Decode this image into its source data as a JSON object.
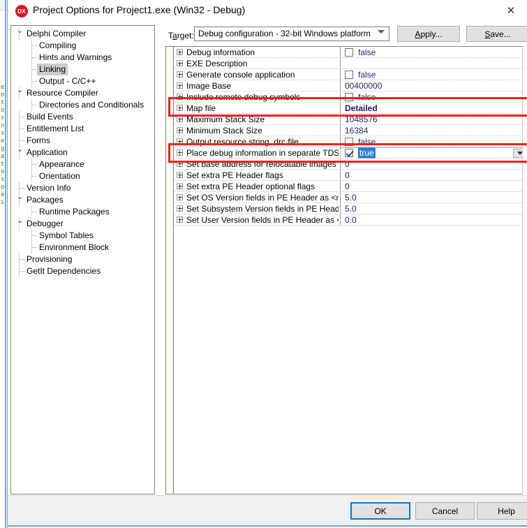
{
  "window": {
    "title": "Project Options for Project1.exe  (Win32 - Debug)",
    "logo_text": "DX",
    "close_icon": "close-icon"
  },
  "tree": {
    "items": [
      {
        "label": "Delphi Compiler",
        "depth": 0,
        "expander": "chevron-down-icon",
        "selected": false
      },
      {
        "label": "Compiling",
        "depth": 1,
        "expander": "",
        "selected": false
      },
      {
        "label": "Hints and Warnings",
        "depth": 1,
        "expander": "",
        "selected": false
      },
      {
        "label": "Linking",
        "depth": 1,
        "expander": "",
        "selected": true
      },
      {
        "label": "Output - C/C++",
        "depth": 1,
        "expander": "",
        "selected": false
      },
      {
        "label": "Resource Compiler",
        "depth": 0,
        "expander": "chevron-down-icon",
        "selected": false
      },
      {
        "label": "Directories and Conditionals",
        "depth": 1,
        "expander": "",
        "selected": false
      },
      {
        "label": "Build Events",
        "depth": 0,
        "expander": "",
        "selected": false
      },
      {
        "label": "Entitlement List",
        "depth": 0,
        "expander": "",
        "selected": false
      },
      {
        "label": "Forms",
        "depth": 0,
        "expander": "",
        "selected": false
      },
      {
        "label": "Application",
        "depth": 0,
        "expander": "chevron-down-icon",
        "selected": false
      },
      {
        "label": "Appearance",
        "depth": 1,
        "expander": "",
        "selected": false
      },
      {
        "label": "Orientation",
        "depth": 1,
        "expander": "",
        "selected": false
      },
      {
        "label": "Version Info",
        "depth": 0,
        "expander": "",
        "selected": false
      },
      {
        "label": "Packages",
        "depth": 0,
        "expander": "chevron-down-icon",
        "selected": false
      },
      {
        "label": "Runtime Packages",
        "depth": 1,
        "expander": "",
        "selected": false
      },
      {
        "label": "Debugger",
        "depth": 0,
        "expander": "chevron-down-icon",
        "selected": false
      },
      {
        "label": "Symbol Tables",
        "depth": 1,
        "expander": "",
        "selected": false
      },
      {
        "label": "Environment Block",
        "depth": 1,
        "expander": "",
        "selected": false
      },
      {
        "label": "Provisioning",
        "depth": 0,
        "expander": "",
        "selected": false
      },
      {
        "label": "GetIt Dependencies",
        "depth": 0,
        "expander": "",
        "selected": false
      }
    ]
  },
  "target": {
    "label_pre": "T",
    "label_accel": "a",
    "label_post": "rget:",
    "value": "Debug configuration - 32-bit Windows platform",
    "dropdown_icon": "chevron-down-icon"
  },
  "toolbar": {
    "apply_pre": "",
    "apply_accel": "A",
    "apply_post": "pply...",
    "save_pre": "",
    "save_accel": "S",
    "save_post": "ave..."
  },
  "grid": {
    "rows": [
      {
        "name": "Debug information",
        "value": "false",
        "kind": "checkbox",
        "checked": false
      },
      {
        "name": "EXE Description",
        "value": "",
        "kind": "text"
      },
      {
        "name": "Generate console application",
        "value": "false",
        "kind": "checkbox",
        "checked": false
      },
      {
        "name": "Image Base",
        "value": "00400000",
        "kind": "text"
      },
      {
        "name": "Include remote debug symbols",
        "value": "false",
        "kind": "checkbox",
        "checked": false
      },
      {
        "name": "Map file",
        "value": "Detailed",
        "kind": "bold"
      },
      {
        "name": "Maximum Stack Size",
        "value": "1048576",
        "kind": "text"
      },
      {
        "name": "Minimum Stack Size",
        "value": "16384",
        "kind": "text"
      },
      {
        "name": "Output resource string .drc file",
        "value": "false",
        "kind": "checkbox",
        "checked": false
      },
      {
        "name": "Place debug information in separate TDS file",
        "value": "true",
        "kind": "editor",
        "checked": true
      },
      {
        "name": "Set base address for relocatable images",
        "value": "0",
        "kind": "text"
      },
      {
        "name": "Set extra PE Header flags",
        "value": "0",
        "kind": "text"
      },
      {
        "name": "Set extra PE Header optional flags",
        "value": "0",
        "kind": "text"
      },
      {
        "name": "Set OS Version fields in PE Header as <major>",
        "value": "5.0",
        "kind": "text"
      },
      {
        "name": "Set Subsystem Version fields in PE Header as <",
        "value": "5.0",
        "kind": "text"
      },
      {
        "name": "Set User Version fields in PE Header as <major",
        "value": "0.0",
        "kind": "text"
      }
    ],
    "editor_dropdown_icon": "chevron-down-icon"
  },
  "annotations": {
    "highlight_color": "#fc1d1d",
    "boxes": [
      "map-file-row",
      "place-debug-info-tds-row"
    ]
  },
  "footer": {
    "ok": "OK",
    "cancel": "Cancel",
    "help": "Help"
  },
  "background_code": {
    "lines": [
      "e",
      "o",
      "t",
      "o",
      "s",
      "n",
      "x",
      "e",
      "g",
      "a",
      "t",
      "o",
      "s",
      "o",
      "e",
      "i"
    ]
  }
}
